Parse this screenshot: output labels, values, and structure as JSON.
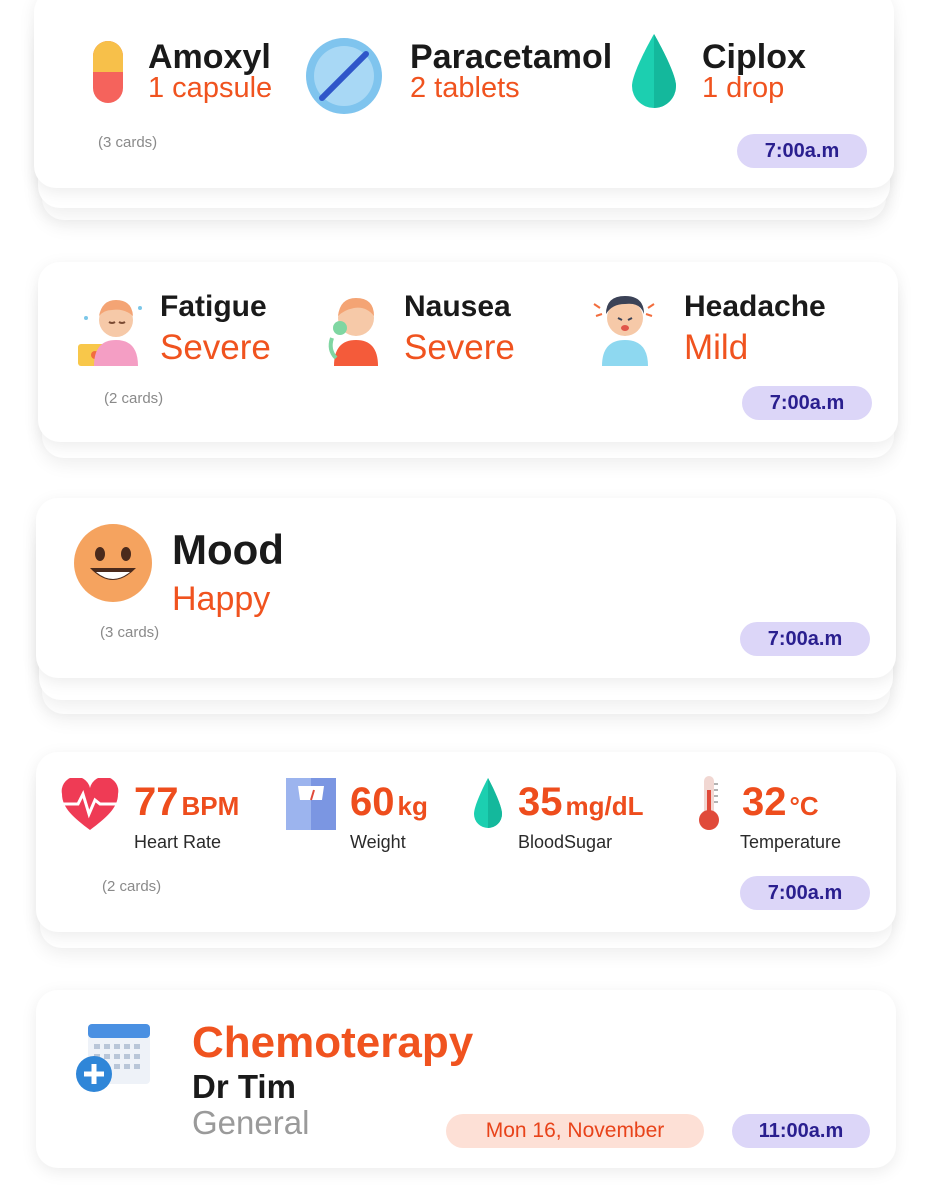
{
  "medications": {
    "items": [
      {
        "name": "Amoxyl",
        "dose": "1 capsule",
        "icon": "capsule-icon"
      },
      {
        "name": "Paracetamol",
        "dose": "2 tablets",
        "icon": "tablet-icon"
      },
      {
        "name": "Ciplox",
        "dose": "1 drop",
        "icon": "drop-icon"
      }
    ],
    "count": "(3 cards)",
    "time": "7:00a.m"
  },
  "symptoms": {
    "items": [
      {
        "name": "Fatigue",
        "severity": "Severe",
        "icon": "fatigue-person-icon"
      },
      {
        "name": "Nausea",
        "severity": "Severe",
        "icon": "nausea-person-icon"
      },
      {
        "name": "Headache",
        "severity": "Mild",
        "icon": "headache-person-icon"
      }
    ],
    "count": "(2 cards)",
    "time": "7:00a.m"
  },
  "mood": {
    "title": "Mood",
    "value": "Happy",
    "icon": "happy-face-icon",
    "count": "(3 cards)",
    "time": "7:00a.m"
  },
  "vitals": {
    "items": [
      {
        "value": "77",
        "unit": "BPM",
        "label": "Heart Rate",
        "icon": "heart-rate-icon"
      },
      {
        "value": "60",
        "unit": "kg",
        "label": "Weight",
        "icon": "scale-icon"
      },
      {
        "value": "35",
        "unit": "mg/dL",
        "label": "BloodSugar",
        "icon": "blood-drop-icon"
      },
      {
        "value": "32",
        "unit": "°C",
        "label": "Temperature",
        "icon": "thermometer-icon"
      }
    ],
    "count": "(2 cards)",
    "time": "7:00a.m"
  },
  "appointment": {
    "title": "Chemoterapy",
    "doctor": "Dr Tim",
    "specialty": "General",
    "date": "Mon 16, November",
    "time": "11:00a.m",
    "icon": "calendar-add-icon"
  },
  "colors": {
    "accent": "#f0531f",
    "pill_bg": "#dcd6f8",
    "pill_text": "#2a1f8f",
    "date_bg": "#fde0d6",
    "teal": "#1ccfb0"
  }
}
